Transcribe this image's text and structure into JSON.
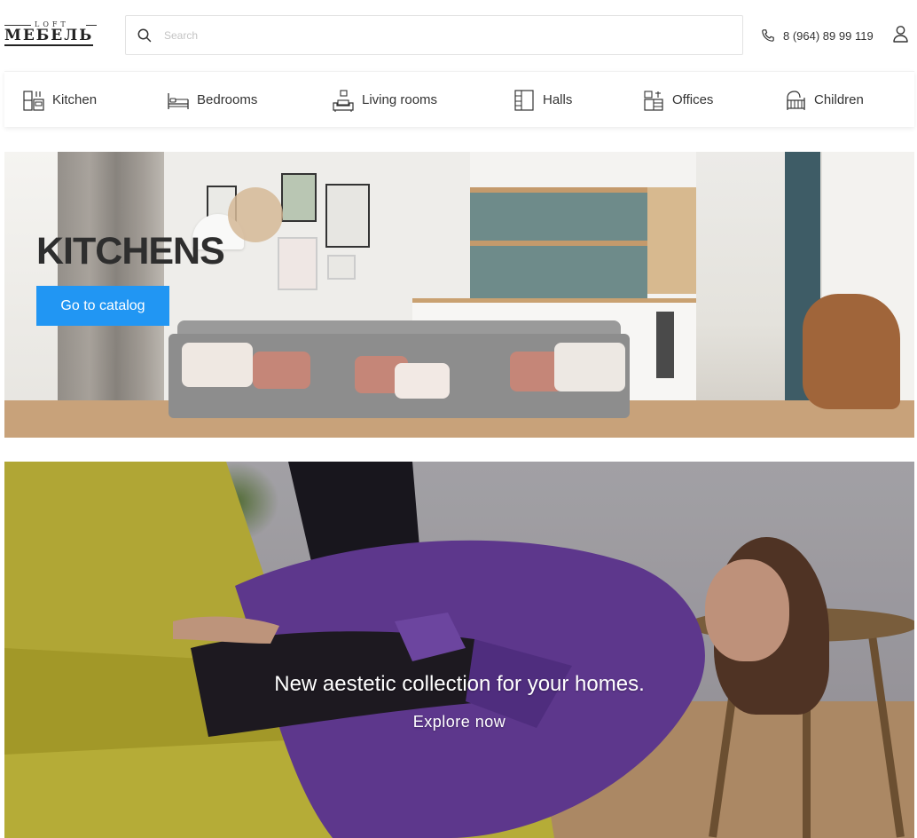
{
  "header": {
    "logo_top": "LOFT",
    "logo_main": "МЕБЕЛЬ",
    "search_placeholder": "Search",
    "phone": "8 (964) 89 99 119"
  },
  "categories": [
    {
      "label": "Kitchen",
      "icon": "kitchen-icon"
    },
    {
      "label": "Bedrooms",
      "icon": "bed-icon"
    },
    {
      "label": "Living rooms",
      "icon": "living-room-icon"
    },
    {
      "label": "Halls",
      "icon": "wardrobe-icon"
    },
    {
      "label": "Offices",
      "icon": "office-icon"
    },
    {
      "label": "Children",
      "icon": "crib-icon"
    }
  ],
  "banner_kitchens": {
    "title": "KITCHENS",
    "button_label": "Go to catalog",
    "button_color": "#2196f3"
  },
  "banner_collection": {
    "title": "New aestetic collection for your homes.",
    "link_label": "Explore now"
  }
}
